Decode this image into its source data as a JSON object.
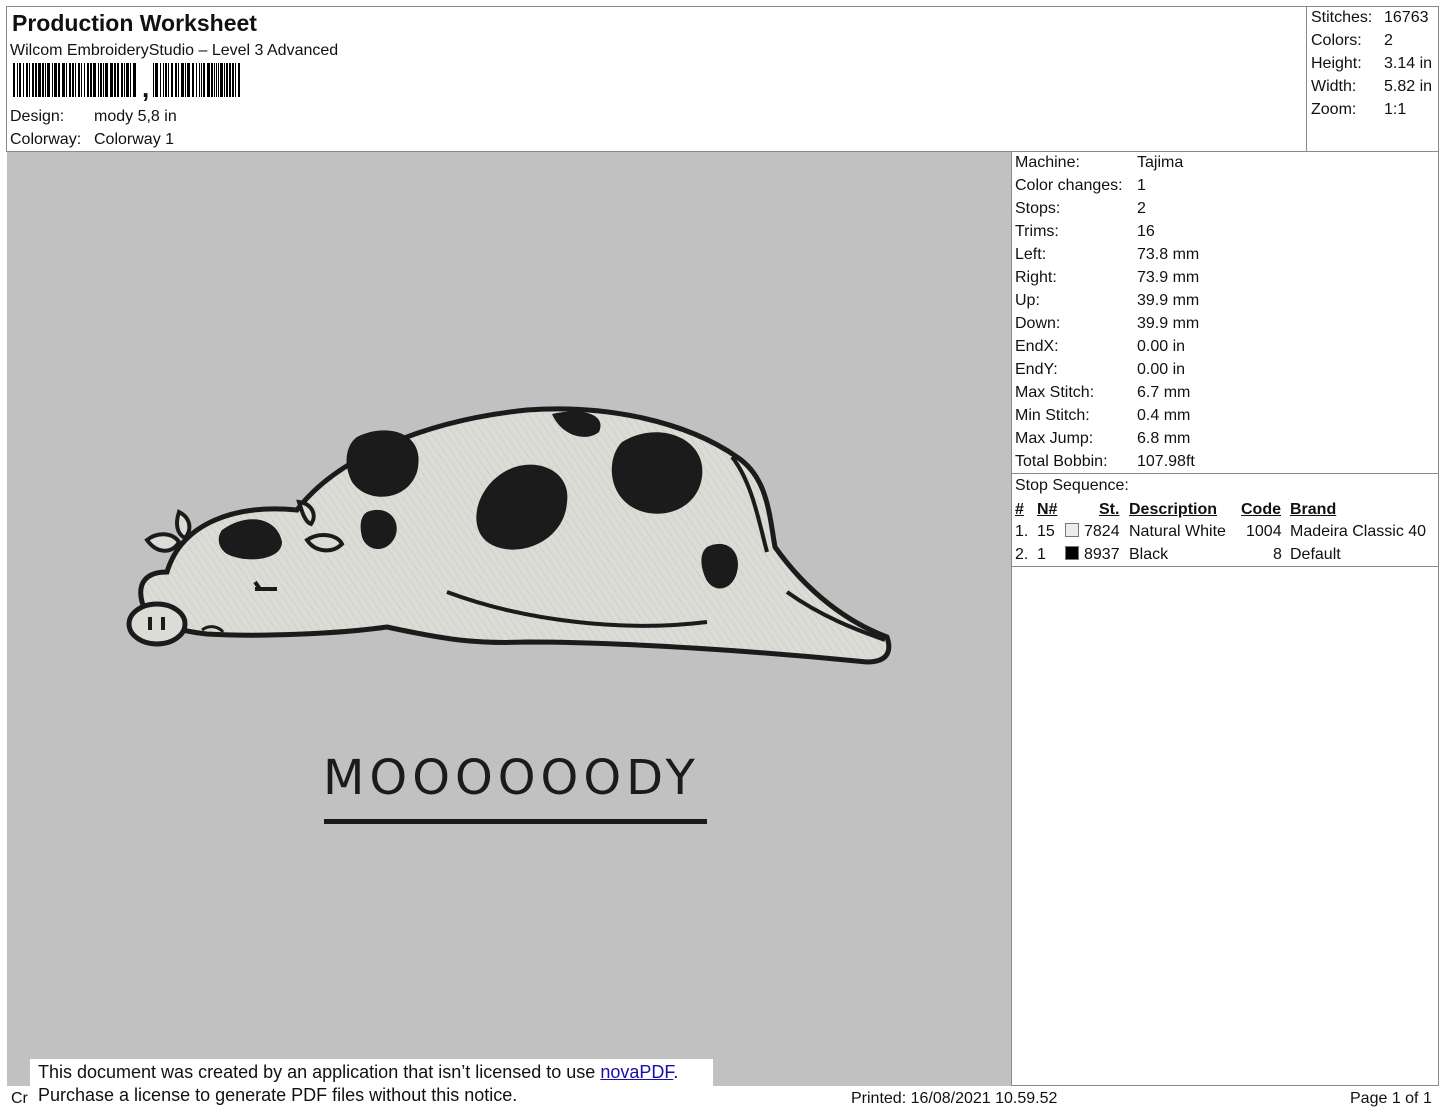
{
  "header": {
    "title": "Production Worksheet",
    "software": "Wilcom EmbroideryStudio – Level 3 Advanced",
    "barcode_mark": ",",
    "design_label": "Design:",
    "design_value": "mody 5,8 in",
    "colorway_label": "Colorway:",
    "colorway_value": "Colorway 1"
  },
  "summary": [
    {
      "label": "Stitches:",
      "value": "16763"
    },
    {
      "label": "Colors:",
      "value": "2"
    },
    {
      "label": "Height:",
      "value": "3.14 in"
    },
    {
      "label": "Width:",
      "value": "5.82 in"
    },
    {
      "label": "Zoom:",
      "value": "1:1"
    }
  ],
  "specs": [
    {
      "label": "Machine:",
      "value": "Tajima"
    },
    {
      "label": "Color changes:",
      "value": "1"
    },
    {
      "label": "Stops:",
      "value": "2"
    },
    {
      "label": "Trims:",
      "value": "16"
    },
    {
      "label": "Left:",
      "value": "73.8 mm"
    },
    {
      "label": "Right:",
      "value": "73.9 mm"
    },
    {
      "label": "Up:",
      "value": "39.9 mm"
    },
    {
      "label": "Down:",
      "value": "39.9 mm"
    },
    {
      "label": "EndX:",
      "value": "0.00 in"
    },
    {
      "label": "EndY:",
      "value": "0.00 in"
    },
    {
      "label": "Max Stitch:",
      "value": "6.7 mm"
    },
    {
      "label": "Min Stitch:",
      "value": "0.4 mm"
    },
    {
      "label": "Max Jump:",
      "value": "6.8 mm"
    },
    {
      "label": "Total Bobbin:",
      "value": "107.98ft"
    }
  ],
  "stop_sequence": {
    "title": "Stop Sequence:",
    "headers": {
      "num": "#",
      "n": "N#",
      "st": "St.",
      "description": "Description",
      "code": "Code",
      "brand": "Brand"
    },
    "rows": [
      {
        "num": "1.",
        "n": "15",
        "color": "#ececec",
        "st": "7824",
        "description": "Natural White",
        "code": "1004",
        "brand": "Madeira Classic 40"
      },
      {
        "num": "2.",
        "n": "1",
        "color": "#000000",
        "st": "8937",
        "description": "Black",
        "code": "8",
        "brand": "Default"
      }
    ]
  },
  "design": {
    "text": "MOOOOOODY",
    "background_color": "#c1c1c1",
    "body_color": "#dcdcd6",
    "outline_color": "#1b1b1b"
  },
  "footer": {
    "left_fragment": "Cr",
    "printed": "Printed: 16/08/2021 10.59.52",
    "page": "Page 1 of 1"
  },
  "notice": {
    "line1_prefix": "This document was created by an application that isn’t licensed to use ",
    "link": "novaPDF",
    "line1_suffix": ".",
    "line2": "Purchase a license to generate PDF files without this notice."
  }
}
